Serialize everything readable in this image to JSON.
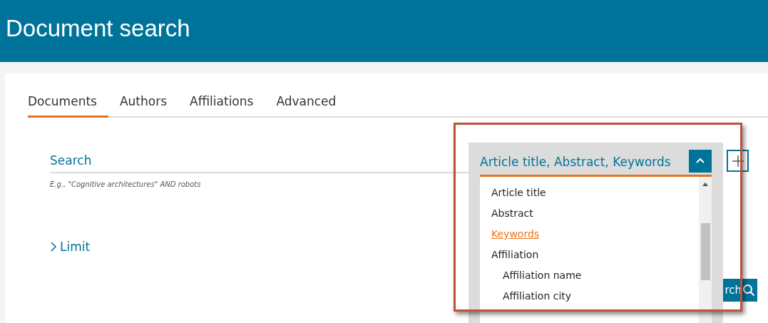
{
  "header": {
    "title": "Document search"
  },
  "tabs": [
    {
      "label": "Documents",
      "selected": true
    },
    {
      "label": "Authors",
      "selected": false
    },
    {
      "label": "Affiliations",
      "selected": false
    },
    {
      "label": "Advanced",
      "selected": false
    }
  ],
  "search": {
    "label": "Search",
    "hint": "E.g., \"Cognitive architectures\" AND robots"
  },
  "field_dropdown": {
    "value": "Article title, Abstract, Keywords",
    "expanded": true,
    "options": [
      {
        "label": "Article title",
        "selected": false
      },
      {
        "label": "Abstract",
        "selected": false
      },
      {
        "label": "Keywords",
        "selected": true
      },
      {
        "label": "Affiliation",
        "selected": false,
        "children": [
          {
            "label": "Affiliation name",
            "selected": false
          },
          {
            "label": "Affiliation city",
            "selected": false
          }
        ]
      }
    ]
  },
  "limit": {
    "label": "Limit",
    "expanded": false
  },
  "search_button": {
    "label": "rch"
  }
}
